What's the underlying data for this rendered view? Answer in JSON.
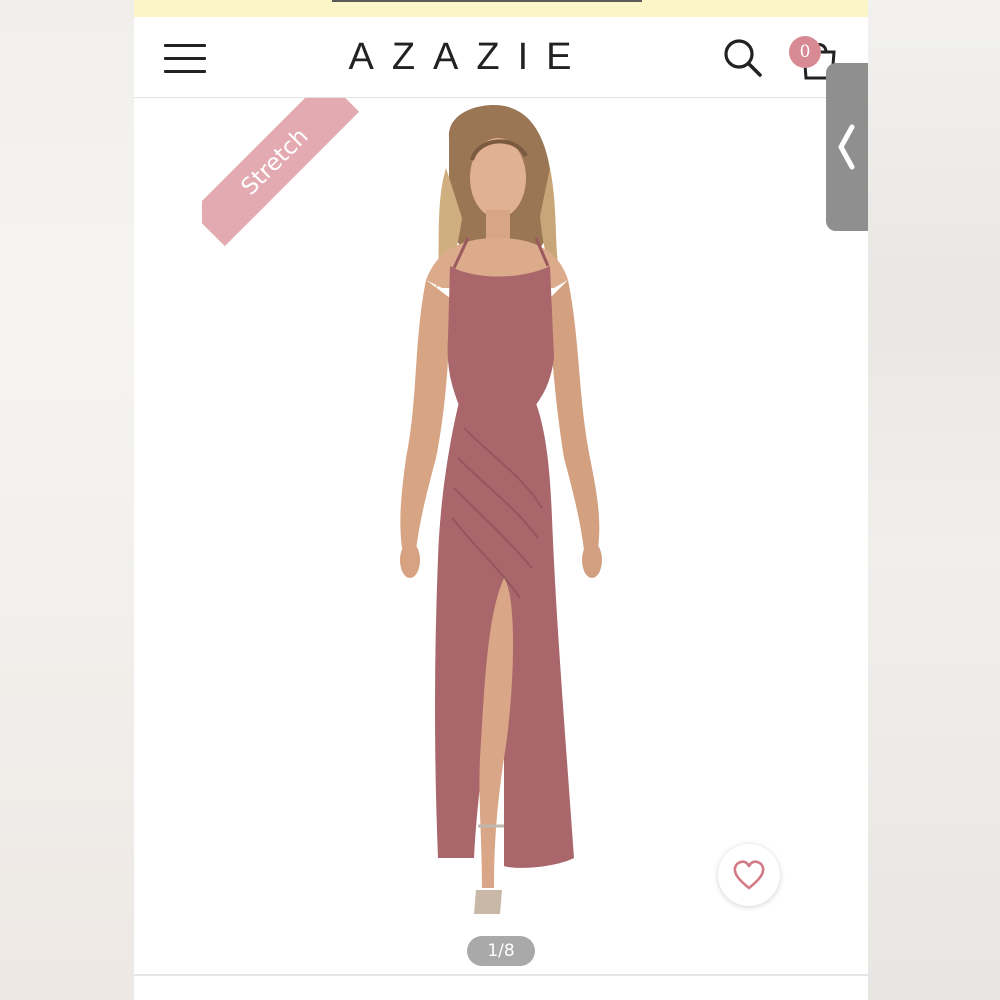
{
  "header": {
    "brand": "AZAZIE",
    "cart_count": "0"
  },
  "icons": {
    "menu": "hamburger-menu-icon",
    "search": "search-icon",
    "cart": "shopping-bag-icon",
    "side_tab": "chevron-left-icon",
    "favorite": "heart-icon"
  },
  "product": {
    "badge": "Stretch",
    "image_counter": "1/8",
    "dress_color": "#a9676b"
  },
  "colors": {
    "promo_bar": "#fbf5c8",
    "badge_bg": "#e3aab1",
    "cart_badge": "#d88a94",
    "side_tab": "#8f8f8f",
    "pager_bg": "#a9a9a9",
    "heart": "#d27a85"
  }
}
